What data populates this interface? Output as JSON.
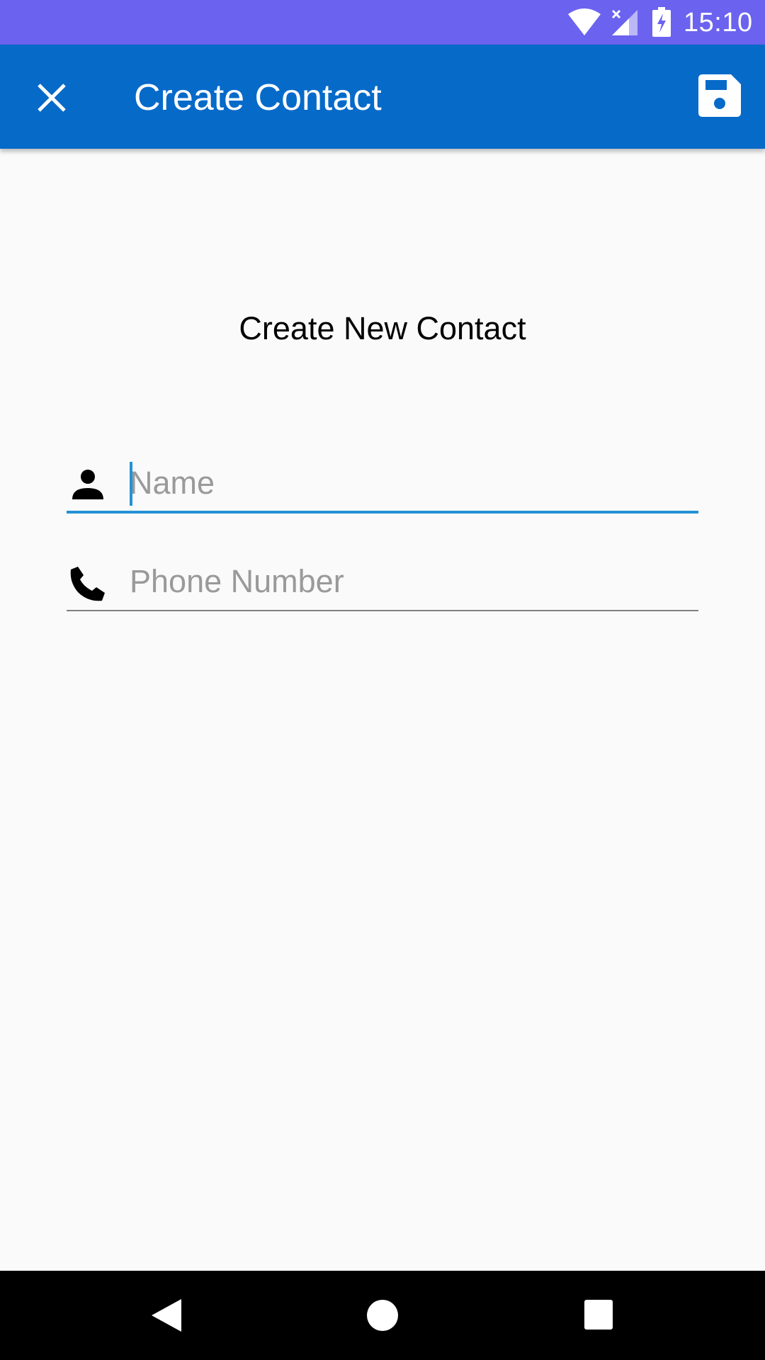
{
  "status_bar": {
    "time": "15:10",
    "background": "#6b63ef",
    "icons": [
      "wifi-icon",
      "cell-signal-icon",
      "battery-charging-icon"
    ]
  },
  "app_bar": {
    "title": "Create Contact",
    "background": "#066ac9",
    "close_icon": "close-icon",
    "save_icon": "save-icon"
  },
  "form": {
    "heading": "Create New Contact",
    "name": {
      "value": "",
      "placeholder": "Name",
      "icon": "person-icon",
      "focused": true,
      "accent": "#2492d6"
    },
    "phone": {
      "value": "",
      "placeholder": "Phone Number",
      "icon": "phone-icon"
    }
  },
  "nav_bar": {
    "buttons": [
      "back-icon",
      "home-icon",
      "recents-icon"
    ]
  }
}
